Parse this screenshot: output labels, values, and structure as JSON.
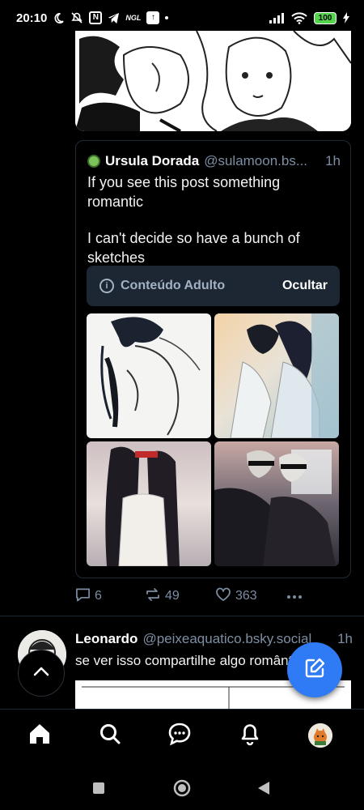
{
  "status_bar": {
    "time": "20:10",
    "icons": [
      "moon-icon",
      "mute-icon",
      "nfc-icon",
      "telegram-icon",
      "ngl-icon",
      "upload-icon",
      "dot-icon"
    ],
    "ngl_label": "NGL",
    "battery": "100",
    "right_icons": [
      "signal-icon",
      "wifi-icon",
      "battery-icon",
      "charging-icon"
    ]
  },
  "quote": {
    "author_name": "Ursula Dorada",
    "author_handle": "@sulamoon.bs...",
    "time": "1h",
    "text_lines": [
      "If you see this post something romantic",
      "I can't decide so have a bunch of sketches"
    ],
    "adult_label": "Conteúdo Adulto",
    "hide_label": "Ocultar"
  },
  "actions": {
    "replies": "6",
    "reposts": "49",
    "likes": "363"
  },
  "post2": {
    "author_name": "Leonardo",
    "author_handle": "@peixeaquatico.bsky.social",
    "time": "1h",
    "text": "se ver isso compartilhe algo romântico"
  },
  "nav": {
    "items": [
      "home-icon",
      "search-icon",
      "chat-icon",
      "bell-icon",
      "profile-avatar"
    ]
  },
  "android_nav": [
    "recents-button",
    "home-button",
    "back-button"
  ],
  "colors": {
    "background": "#000000",
    "accent": "#2f7bf5",
    "muted": "#7d8ea3",
    "label_bg": "#1c2733"
  }
}
